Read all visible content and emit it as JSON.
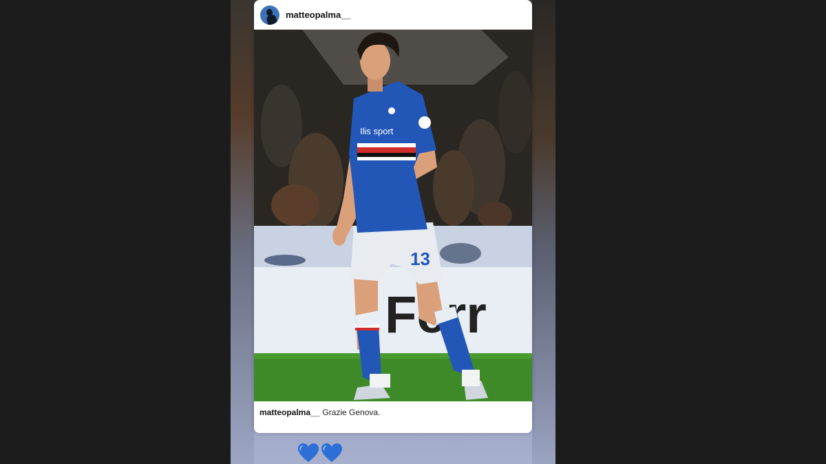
{
  "post": {
    "username": "matteopalma__",
    "caption_user": "matteopalma__",
    "caption_text": "Grazie Genova.",
    "photo": {
      "jersey_sponsor": "Ilis sport",
      "shorts_number": "13",
      "board_text": "Ferr"
    }
  },
  "story": {
    "stickers": [
      "blue-heart-icon",
      "blue-heart-icon"
    ]
  },
  "colors": {
    "jersey_blue": "#2257b8",
    "heart_blue": "#2d6fd6",
    "pitch_green": "#3e8a28"
  }
}
